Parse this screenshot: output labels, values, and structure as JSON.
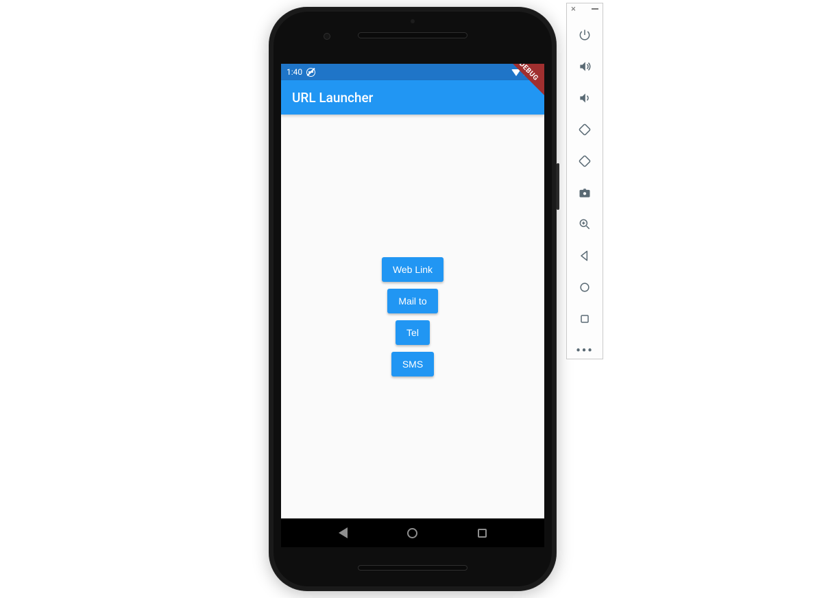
{
  "status_bar": {
    "time": "1:40"
  },
  "app_bar": {
    "title": "URL Launcher"
  },
  "debug_banner": "DEBUG",
  "buttons": {
    "web_link": "Web Link",
    "mail_to": "Mail to",
    "tel": "Tel",
    "sms": "SMS"
  },
  "emulator_toolbar": {
    "close": "×",
    "more": "•••"
  }
}
